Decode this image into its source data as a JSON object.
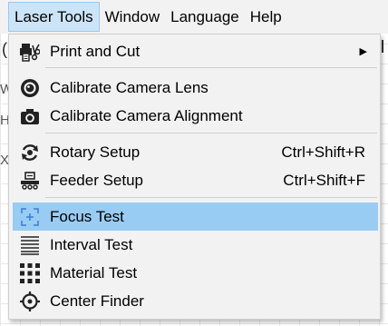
{
  "menubar": {
    "items": [
      "Laser Tools",
      "Window",
      "Language",
      "Help"
    ]
  },
  "background": {
    "fragments": [
      "(",
      "W",
      "H",
      "X"
    ]
  },
  "dropdown": {
    "items": [
      {
        "label": "Print and Cut",
        "icon": "print-cut-icon",
        "submenu": true,
        "submenu_glyph": "▶"
      },
      {
        "label": "Calibrate Camera Lens",
        "icon": "camera-lens-icon"
      },
      {
        "label": "Calibrate Camera Alignment",
        "icon": "camera-icon"
      },
      {
        "label": "Rotary Setup",
        "icon": "rotary-icon",
        "shortcut": "Ctrl+Shift+R"
      },
      {
        "label": "Feeder Setup",
        "icon": "feeder-icon",
        "shortcut": "Ctrl+Shift+F"
      },
      {
        "label": "Focus Test",
        "icon": "focus-icon",
        "highlighted": true
      },
      {
        "label": "Interval Test",
        "icon": "interval-lines-icon"
      },
      {
        "label": "Material Test",
        "icon": "grid-icon"
      },
      {
        "label": "Center Finder",
        "icon": "crosshair-icon"
      }
    ]
  },
  "colors": {
    "menubar_bg": "#f2f2f2",
    "open_menu_bg": "#cce4f7",
    "highlight_bg": "#99ccf3",
    "focus_icon": "#3a7bd5"
  }
}
